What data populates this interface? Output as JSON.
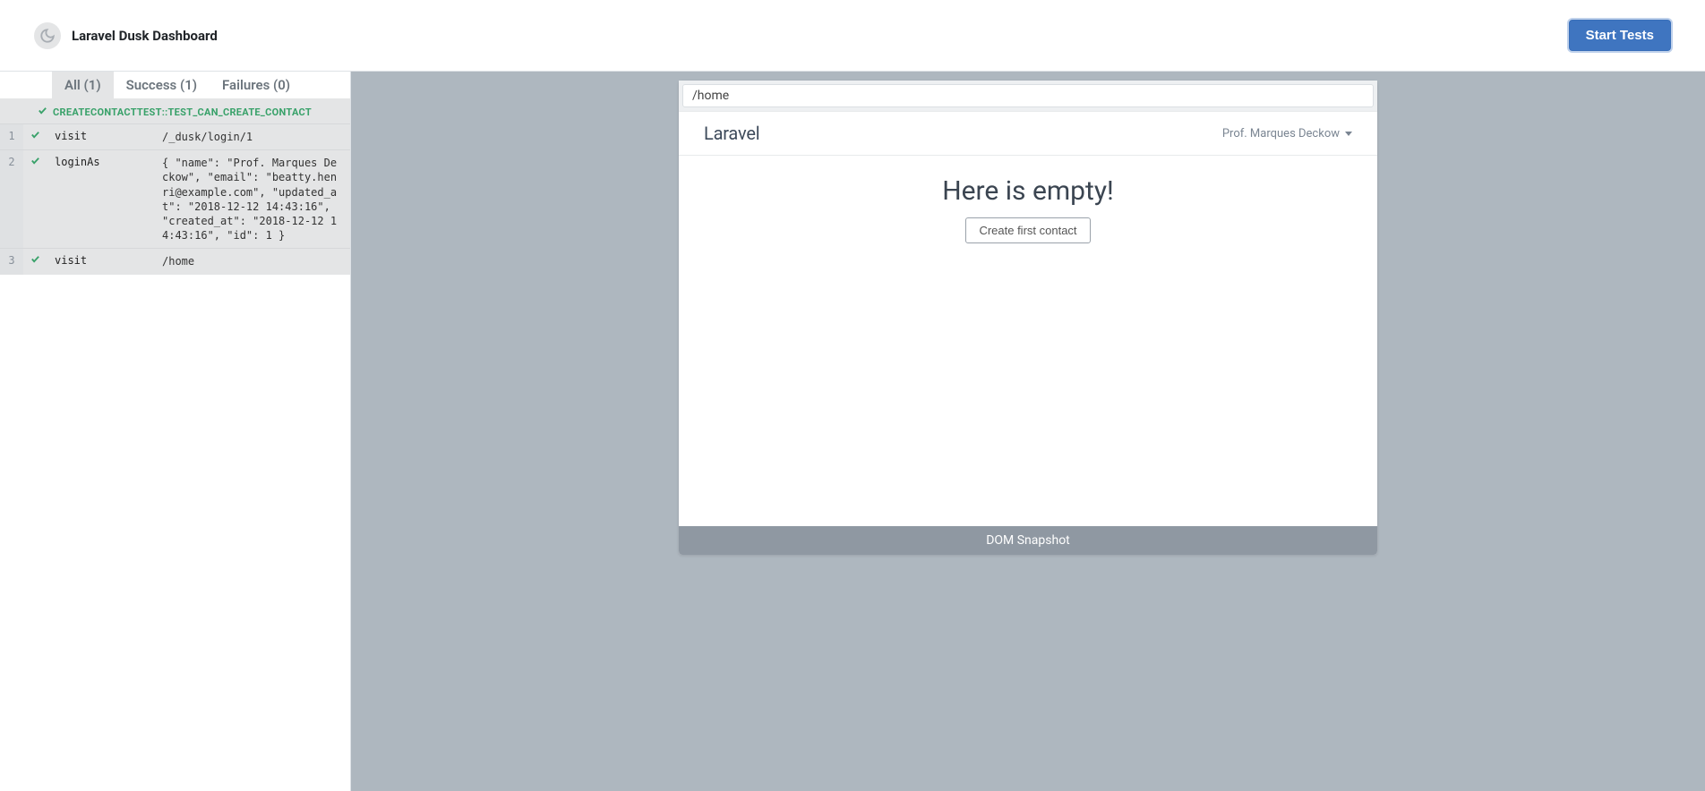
{
  "header": {
    "title": "Laravel Dusk Dashboard",
    "start_tests_label": "Start Tests"
  },
  "tabs": [
    {
      "label": "All (1)",
      "active": true
    },
    {
      "label": "Success (1)",
      "active": false
    },
    {
      "label": "Failures (0)",
      "active": false
    }
  ],
  "test": {
    "name": "CREATECONTACTTEST::TEST_CAN_CREATE_CONTACT",
    "steps": [
      {
        "num": "1",
        "action": "visit",
        "detail": "/_dusk/login/1"
      },
      {
        "num": "2",
        "action": "loginAs",
        "detail": "{ \"name\": \"Prof. Marques Deckow\", \"email\": \"beatty.henri@example.com\", \"updated_at\": \"2018-12-12 14:43:16\", \"created_at\": \"2018-12-12 14:43:16\", \"id\": 1 }"
      },
      {
        "num": "3",
        "action": "visit",
        "detail": "/home"
      }
    ]
  },
  "preview": {
    "url": "/home",
    "brand": "Laravel",
    "user_name": "Prof. Marques Deckow",
    "empty_title": "Here is empty!",
    "create_button_label": "Create first contact",
    "footer_label": "DOM Snapshot"
  }
}
